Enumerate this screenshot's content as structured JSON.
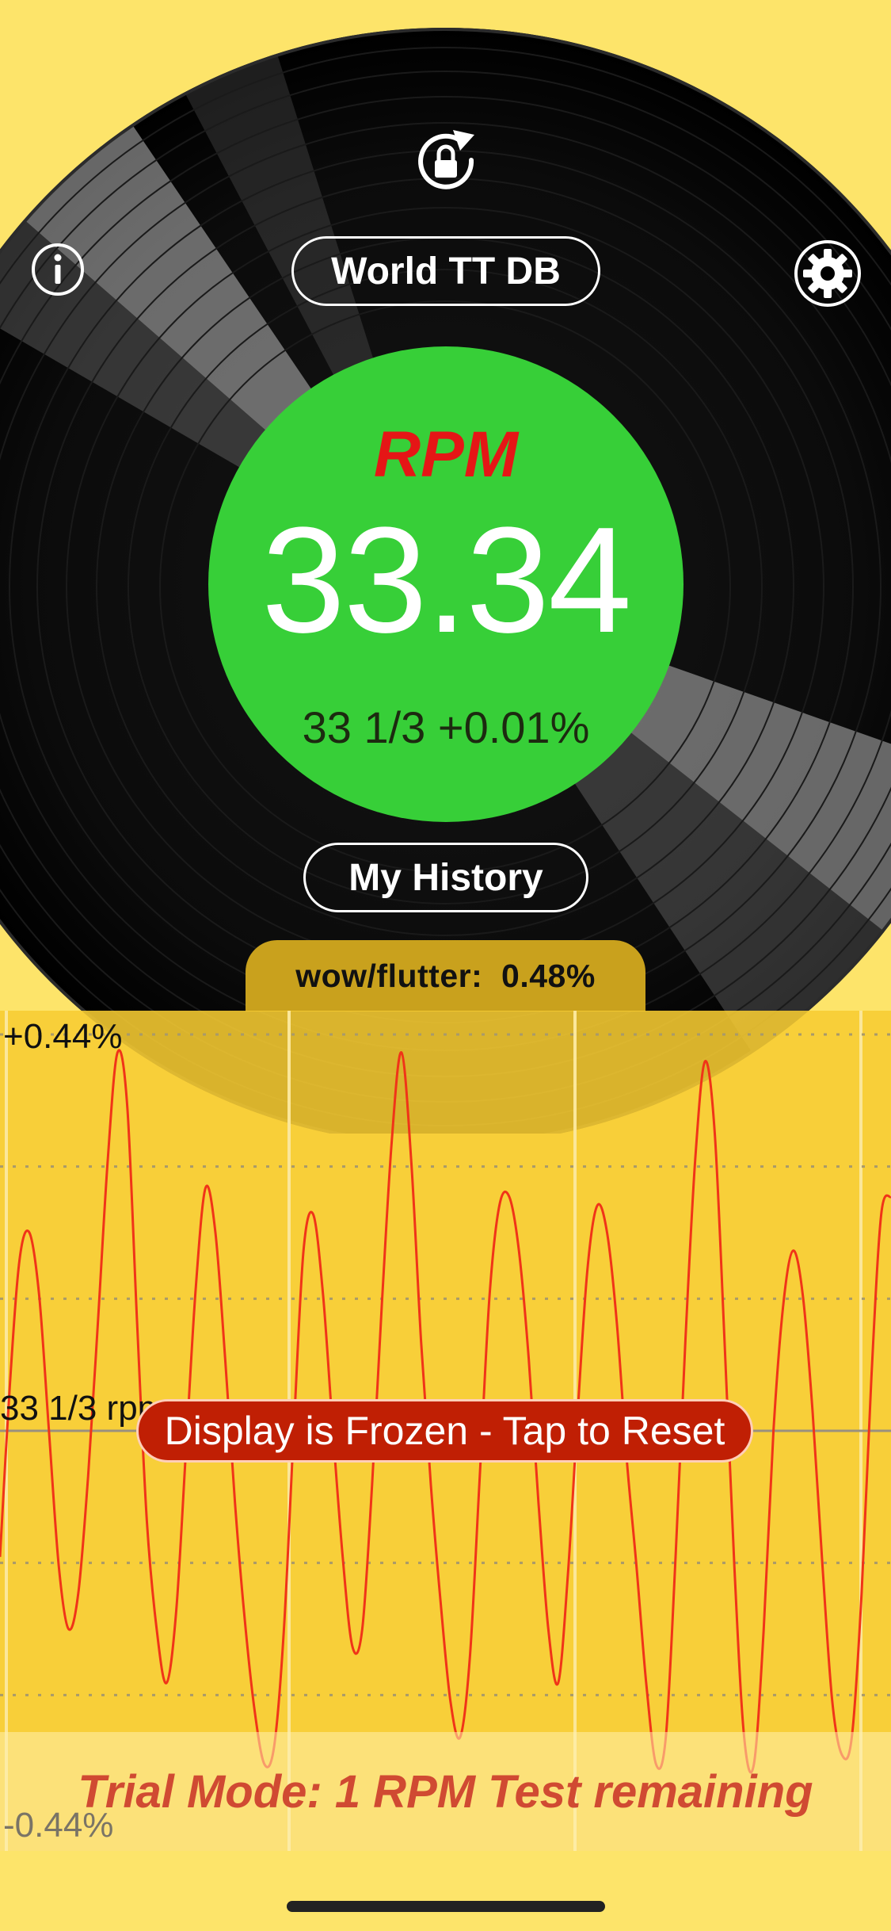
{
  "header": {
    "db_button_label": "World TT DB",
    "history_button_label": "My History"
  },
  "icons": {
    "rotation_lock": "rotation-lock-icon",
    "info": "info-icon",
    "settings": "gear-icon"
  },
  "reading": {
    "label": "RPM",
    "value": "33.34",
    "deviation": "33 1/3 +0.01%"
  },
  "wow_flutter": {
    "label": "wow/flutter:  0.48%"
  },
  "graph": {
    "y_max_label": "+0.44%",
    "y_mid_label": "33 1/3 rpm",
    "y_min_label": "-0.44%",
    "frozen_label": "Display is Frozen - Tap to Reset"
  },
  "trial": {
    "text": "Trial Mode: 1 RPM Test remaining"
  },
  "colors": {
    "background": "#fde46a",
    "reading_circle": "#37cf38",
    "rpm_label": "#e51616",
    "trace": "#f03418",
    "frozen_banner": "#c01f04"
  },
  "chart_data": {
    "type": "line",
    "xlabel": "",
    "ylabel": "",
    "ylim": [
      -0.44,
      0.44
    ],
    "y_labels": [
      "+0.44%",
      "33 1/3 rpm",
      "-0.44%"
    ],
    "series": [
      {
        "values": [
          -0.14,
          0.05,
          0.19,
          0.22,
          0.15,
          0.0,
          -0.15,
          -0.22,
          -0.18,
          -0.05,
          0.12,
          0.3,
          0.42,
          0.36,
          0.12,
          -0.1,
          -0.22,
          -0.28,
          -0.2,
          -0.02,
          0.16,
          0.27,
          0.22,
          0.08,
          -0.08,
          -0.21,
          -0.31,
          -0.37,
          -0.35,
          -0.22,
          0.0,
          0.2,
          0.24,
          0.15,
          0.0,
          -0.14,
          -0.24,
          -0.22,
          -0.06,
          0.14,
          0.32,
          0.42,
          0.3,
          0.1,
          -0.06,
          -0.19,
          -0.3,
          -0.34,
          -0.25,
          -0.05,
          0.15,
          0.25,
          0.26,
          0.2,
          0.08,
          -0.08,
          -0.22,
          -0.28,
          -0.16,
          0.02,
          0.18,
          0.25,
          0.22,
          0.12,
          -0.03,
          -0.15,
          -0.28,
          -0.37,
          -0.34,
          -0.14,
          0.1,
          0.3,
          0.41,
          0.33,
          0.1,
          -0.15,
          -0.34,
          -0.37,
          -0.22,
          0.0,
          0.14,
          0.2,
          0.15,
          0.02,
          -0.15,
          -0.3,
          -0.36,
          -0.34,
          -0.18,
          0.06,
          0.24,
          0.26
        ]
      }
    ]
  }
}
